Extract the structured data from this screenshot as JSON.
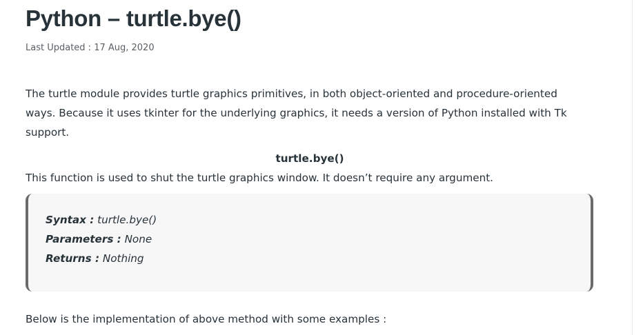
{
  "article": {
    "title": "Python – turtle.bye()",
    "last_updated": "Last Updated : 17 Aug, 2020",
    "intro": "The turtle module provides turtle graphics primitives, in both object-oriented and procedure-oriented ways. Because it uses tkinter for the underlying graphics, it needs a version of Python installed with Tk support.",
    "method_heading": "turtle.bye()",
    "description": "This function is used to shut the turtle graphics window. It doesn’t require any argument.",
    "syntax_block": {
      "syntax_label": "Syntax :",
      "syntax_value": "turtle.bye()",
      "parameters_label": "Parameters :",
      "parameters_value": "None",
      "returns_label": "Returns :",
      "returns_value": "Nothing"
    },
    "examples_intro": "Below is the implementation of above method with some examples :"
  }
}
